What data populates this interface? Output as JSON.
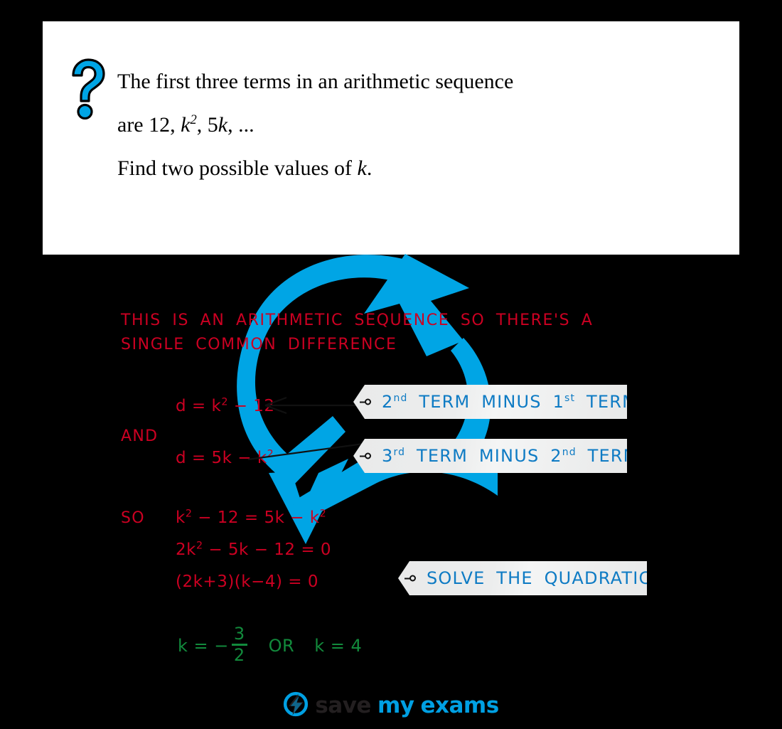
{
  "question": {
    "icon": "question-mark-icon",
    "lines": [
      "The first three terms in an arithmetic sequence",
      "are 12, k², 5k, ...",
      "Find two possible values of k."
    ],
    "line1": "The first three terms in an arithmetic sequence",
    "line2_prefix": "are 12, ",
    "line2_var": "k",
    "line2_sup": "2",
    "line2_mid": ", 5",
    "line2_var2": "k",
    "line2_suffix": ", ...",
    "line3_prefix": "Find two possible values of ",
    "line3_var": "k",
    "line3_suffix": "."
  },
  "solution": {
    "note": "THIS IS AN ARITHMETIC SEQUENCE SO THERE'S A\nSINGLE COMMON DIFFERENCE",
    "eq_d1": "d = k",
    "eq_d1_sup": "2",
    "eq_d1_rest": " − 12",
    "connector_and": "AND",
    "eq_d2": "d = 5k − k",
    "eq_d2_sup": "2",
    "connector_so": "SO",
    "eq_main": "k",
    "eq_main_sup": "2",
    "eq_main_rest": " − 12 = 5k − k",
    "eq_main_sup2": "2",
    "eq_quad": "2k",
    "eq_quad_sup": "2",
    "eq_quad_rest": " − 5k − 12 = 0",
    "eq_factored": "(2k+3)(k−4) = 0",
    "answer_prefix": "k = −",
    "answer_num": "3",
    "answer_den": "2",
    "answer_or": "OR",
    "answer_second": "k = 4"
  },
  "callouts": [
    {
      "id": "second-minus-first",
      "pre": "2",
      "sup": "nd",
      "mid": " TERM  MINUS  1",
      "sup2": "st",
      "post": " TERM"
    },
    {
      "id": "third-minus-second",
      "pre": "3",
      "sup": "rd",
      "mid": " TERM  MINUS  2",
      "sup2": "nd",
      "post": " TERM"
    },
    {
      "id": "solve-the-quadratic",
      "text": "SOLVE  THE  QUADRATIC"
    }
  ],
  "footer": {
    "logo_icon": "lightning-bolt-circle-icon",
    "word_save": "save",
    "word_my": "my",
    "word_exams": "exams"
  },
  "colors": {
    "brand_blue": "#00A0E3",
    "tag_blue": "#0E7BC4",
    "note_red": "#CC0022",
    "answer_green": "#128A3C",
    "background": "#000000",
    "card": "#FFFFFF"
  }
}
